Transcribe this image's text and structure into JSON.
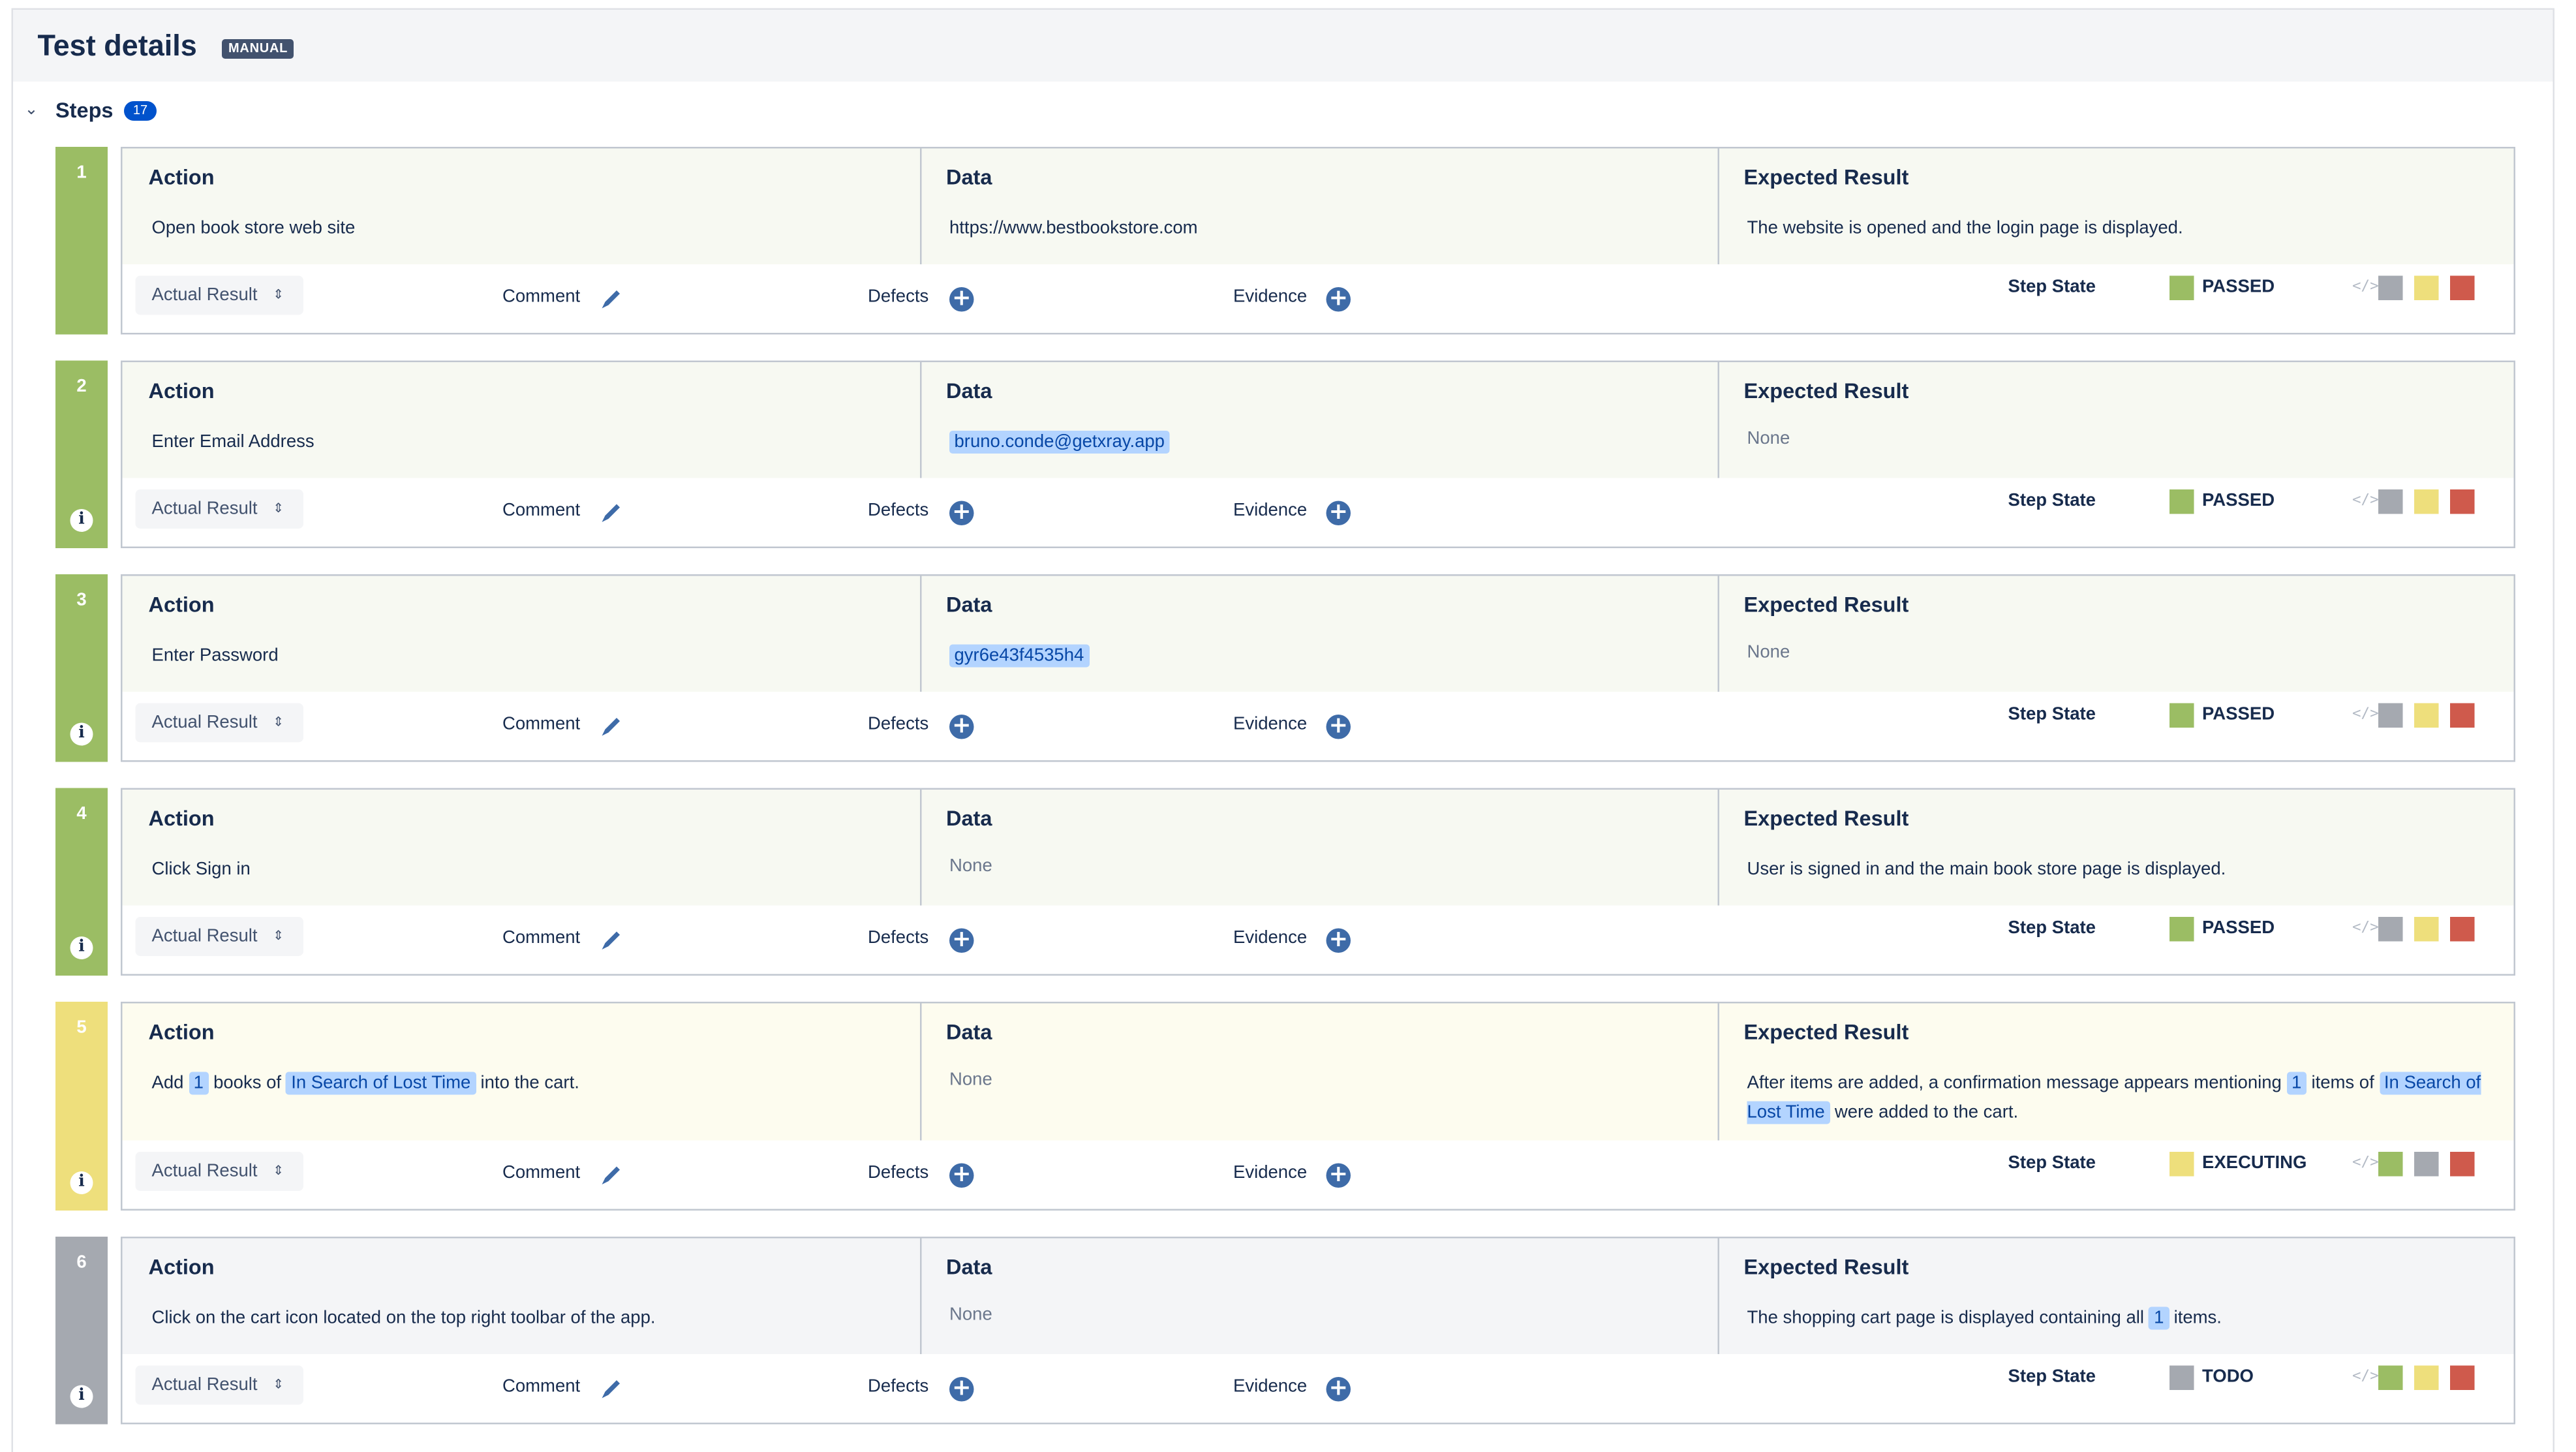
{
  "header": {
    "title": "Test details",
    "badge": "MANUAL"
  },
  "steps_section": {
    "label": "Steps",
    "count": "17"
  },
  "labels": {
    "action": "Action",
    "data": "Data",
    "expected": "Expected Result",
    "actual_result": "Actual Result",
    "comment": "Comment",
    "defects": "Defects",
    "evidence": "Evidence",
    "step_state": "Step State"
  },
  "icons": {
    "collapse": "chevron-down-icon",
    "dropdown": "chevron-updown-icon",
    "comment": "pencil-icon",
    "defects": "plus-circle-icon",
    "evidence": "plus-circle-icon",
    "info": "info-icon",
    "code": "code-icon"
  },
  "state_colors": {
    "PASSED": "#9bbd64",
    "EXECUTING": "#eedf7c",
    "TODO": "#a5a9b0",
    "FAILED": "#cf5a4c"
  },
  "steps": [
    {
      "number": "1",
      "action": "Open book store web site",
      "data": "https://www.bestbookstore.com",
      "expected": "The website is opened and the login page is displayed.",
      "state": "PASSED",
      "state_color": "#9bbd64",
      "bar_color": "#9bbd64",
      "options": [
        "#a5a9b0",
        "#eedf7c",
        "#cf5a4c"
      ]
    },
    {
      "number": "2",
      "action": "Enter Email Address",
      "data": "bruno.conde@getxray.app",
      "expected": "None",
      "state": "PASSED",
      "state_color": "#9bbd64",
      "bar_color": "#9bbd64",
      "options": [
        "#a5a9b0",
        "#eedf7c",
        "#cf5a4c"
      ]
    },
    {
      "number": "3",
      "action": "Enter Password",
      "data": "gyr6e43f4535h4",
      "expected": "None",
      "state": "PASSED",
      "state_color": "#9bbd64",
      "bar_color": "#9bbd64",
      "options": [
        "#a5a9b0",
        "#eedf7c",
        "#cf5a4c"
      ]
    },
    {
      "number": "4",
      "action": "Click Sign in",
      "data": "None",
      "expected": "User is signed in and the main book store page is displayed.",
      "state": "PASSED",
      "state_color": "#9bbd64",
      "bar_color": "#9bbd64",
      "options": [
        "#a5a9b0",
        "#eedf7c",
        "#cf5a4c"
      ]
    },
    {
      "number": "5",
      "action_parts": {
        "t1": "Add",
        "p1": "1",
        "t2": "books of",
        "p2": "In Search of Lost Time",
        "t3": "into the cart."
      },
      "data": "None",
      "expected_parts": {
        "t1": "After items are added, a confirmation message appears mentioning",
        "p1": "1",
        "t2": "items of",
        "p2": "In Search of Lost Time",
        "t3": "were added to the cart."
      },
      "state": "EXECUTING",
      "state_color": "#eedf7c",
      "bar_color": "#eedf7c",
      "options": [
        "#9bbd64",
        "#a5a9b0",
        "#cf5a4c"
      ]
    },
    {
      "number": "6",
      "action": "Click on the cart icon located on the top right toolbar of the app.",
      "data": "None",
      "expected_parts": {
        "t1": "The shopping cart page is displayed containing all",
        "p1": "1",
        "t2": "items."
      },
      "state": "TODO",
      "state_color": "#a5a9b0",
      "bar_color": "#a5a9b0",
      "options": [
        "#9bbd64",
        "#eedf7c",
        "#cf5a4c"
      ]
    }
  ]
}
